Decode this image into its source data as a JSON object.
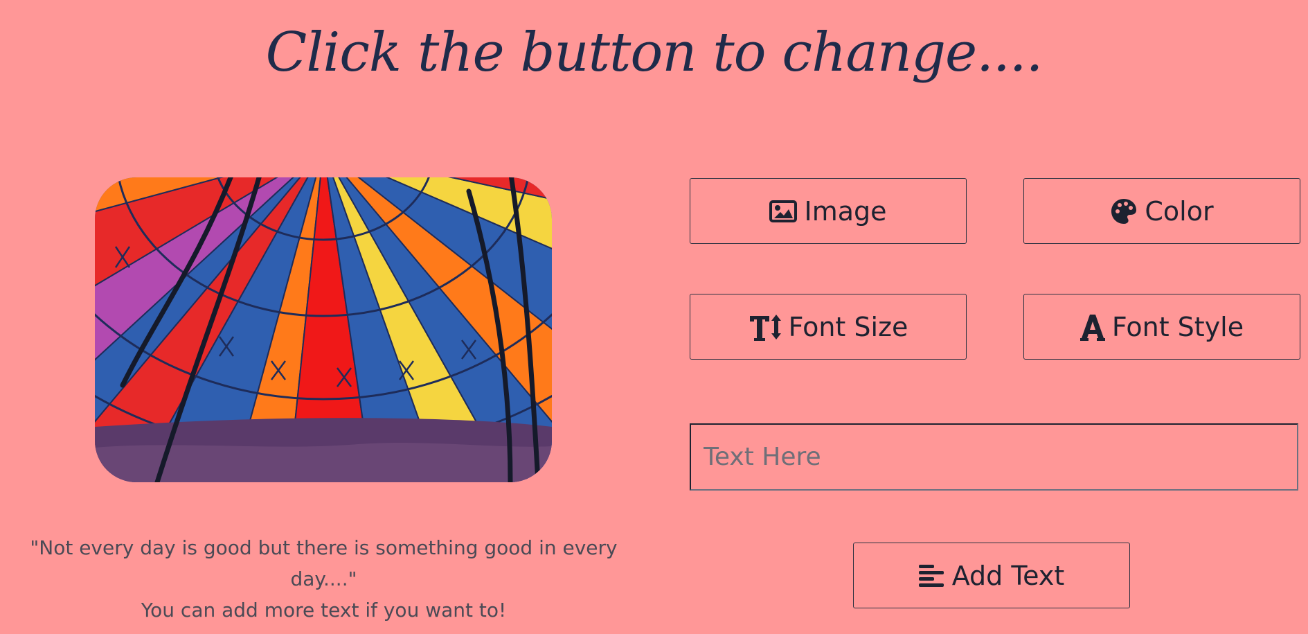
{
  "title": "Click the button to change....",
  "buttons": {
    "image": {
      "label": "Image",
      "icon": "image-icon"
    },
    "color": {
      "label": "Color",
      "icon": "palette-icon"
    },
    "font_size": {
      "label": "Font Size",
      "icon": "text-height-icon"
    },
    "font_style": {
      "label": "Font Style",
      "icon": "font-icon"
    },
    "add_text": {
      "label": "Add Text",
      "icon": "align-left-icon"
    }
  },
  "text_input": {
    "placeholder": "Text Here",
    "value": ""
  },
  "quote": {
    "line1": "\"Not every day is good but there is something good in every day....\"",
    "line2": "You can add more text if you want to!"
  },
  "colors": {
    "background": "#ff9797",
    "title": "#1f2b4a",
    "text": "#4a4a55"
  }
}
